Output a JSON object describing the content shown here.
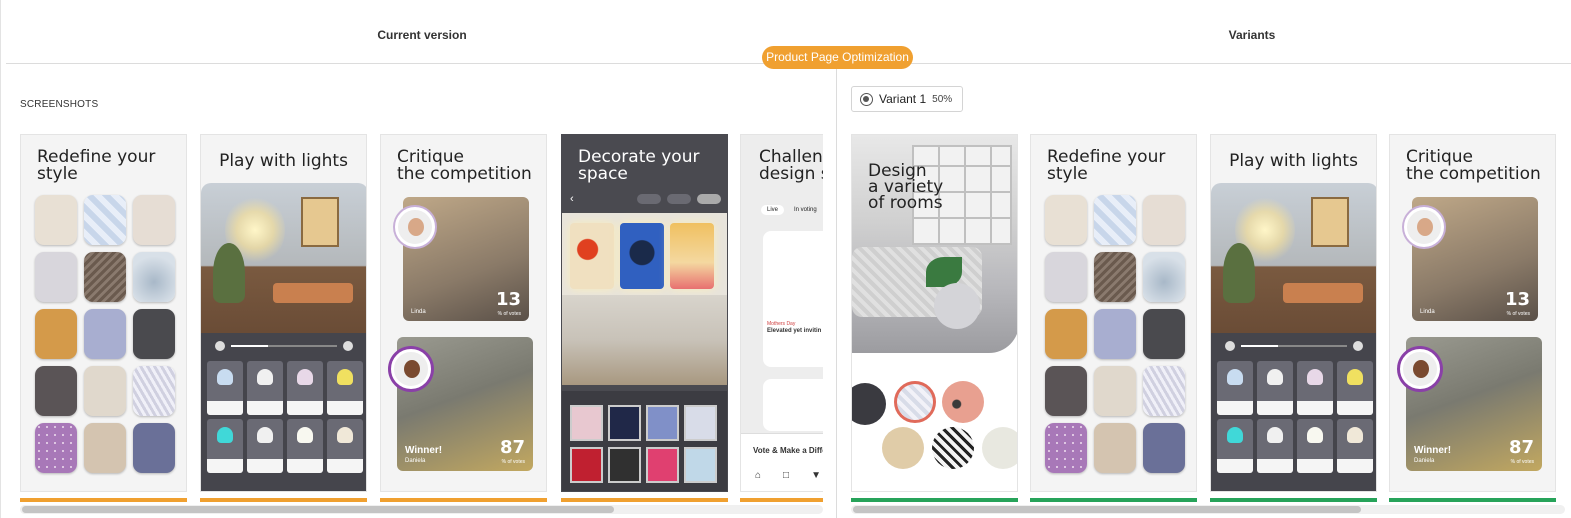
{
  "header": {
    "current_title": "Current version",
    "variants_title": "Variants",
    "badge": "Product Page Optimization"
  },
  "section": {
    "label": "SCREENSHOTS"
  },
  "variant_chip": {
    "name": "Variant 1",
    "percent": "50%"
  },
  "current_cards": [
    {
      "caption": "Redefine your\nstyle"
    },
    {
      "caption": "Play with lights"
    },
    {
      "caption": "Critique\nthe competition"
    },
    {
      "caption": "Decorate your\nspace"
    },
    {
      "caption": "Challenge\ndesign sk"
    }
  ],
  "variant_cards": [
    {
      "caption": "Design\na variety\nof rooms"
    },
    {
      "caption": "Redefine your\nstyle"
    },
    {
      "caption": "Play with lights"
    },
    {
      "caption": "Critique\nthe competition"
    }
  ],
  "vote": {
    "top_number": "13",
    "top_sub": "% of votes",
    "top_name": "Linda",
    "bottom_number": "87",
    "bottom_sub": "% of votes",
    "winner": "Winner!",
    "bottom_name": "Daniela"
  },
  "phone": {
    "tab_live": "Live",
    "tab_voting": "In voting",
    "event": "Mothers Day",
    "title": "Elevated yet invitin",
    "footer": "Vote & Make a Differe"
  },
  "colors": {
    "current_accent": "#f0a030",
    "variant_accent": "#27a35a",
    "badge_bg": "#f0a030"
  },
  "icons": [
    "radio-selected-icon",
    "home-icon",
    "clipboard-icon",
    "cart-icon"
  ]
}
